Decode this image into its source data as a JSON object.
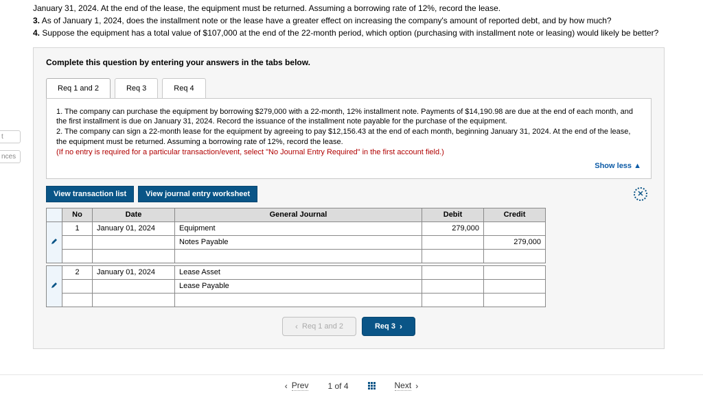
{
  "top": {
    "l1": "January 31, 2024. At the end of the lease, the equipment must be returned. Assuming a borrowing rate of 12%, record the lease.",
    "l2a": "3.",
    "l2b": " As of January 1, 2024, does the installment note or the lease have a greater effect on increasing the company's amount of reported debt, and by how much?",
    "l3a": "4.",
    "l3b": " Suppose the equipment has a total value of $107,000 at the end of the 22-month period, which option (purchasing with installment note or leasing) would likely be better?"
  },
  "leftStubs": [
    "t",
    "nces"
  ],
  "instruction": "Complete this question by entering your answers in the tabs below.",
  "tabs": [
    "Req 1 and 2",
    "Req 3",
    "Req 4"
  ],
  "tabdesc": {
    "p1": "1. The company can purchase the equipment by borrowing $279,000 with a 22-month, 12% installment note. Payments of $14,190.98 are due at the end of each month, and the first installment is due on January 31, 2024. Record the issuance of the installment note payable for the purchase of the equipment.",
    "p2": "2. The company can sign a 22-month lease for the equipment by agreeing to pay $12,156.43 at the end of each month, beginning January 31, 2024. At the end of the lease, the equipment must be returned. Assuming a borrowing rate of 12%, record the lease.",
    "p3": "(If no entry is required for a particular transaction/event, select \"No Journal Entry Required\" in the first account field.)"
  },
  "showless": "Show less ▲",
  "viewBtns": {
    "list": "View transaction list",
    "ws": "View journal entry worksheet"
  },
  "table": {
    "headers": {
      "no": "No",
      "date": "Date",
      "gj": "General Journal",
      "debit": "Debit",
      "credit": "Credit"
    },
    "e1": {
      "no": "1",
      "date": "January 01, 2024",
      "a1": "Equipment",
      "d1": "279,000",
      "a2": "Notes Payable",
      "c2": "279,000"
    },
    "e2": {
      "no": "2",
      "date": "January 01, 2024",
      "a1": "Lease Asset",
      "a2": "Lease Payable"
    }
  },
  "pills": {
    "prev": "Req 1 and 2",
    "next": "Req 3"
  },
  "footer": {
    "prev": "Prev",
    "page": "1 of 4",
    "next": "Next"
  }
}
